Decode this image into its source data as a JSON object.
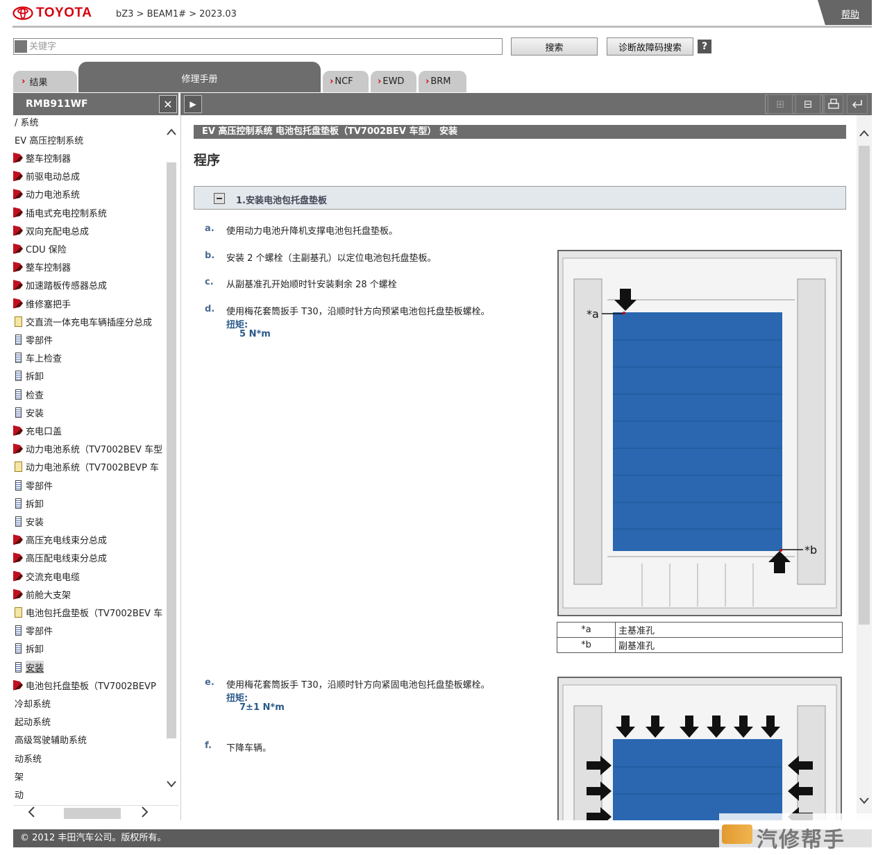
{
  "brand": {
    "name": "TOYOTA",
    "color": "#d7000f"
  },
  "breadcrumb": "bZ3 > BEAM1# > 2023.03",
  "help_label": "帮助",
  "search": {
    "placeholder": "关键字",
    "value": "",
    "search_button": "搜索",
    "dtc_button": "诊断故障码搜索",
    "help_button": "?"
  },
  "tabs": {
    "results": "结果",
    "manual": "修理手册",
    "ncf": "NCF",
    "ewd": "EWD",
    "brm": "BRM"
  },
  "left_panel": {
    "title": "RMB911WF",
    "tree": [
      {
        "label": "/ 系统",
        "icon": "none"
      },
      {
        "label": "EV 高压控制系统",
        "icon": "none"
      },
      {
        "label": "整车控制器",
        "icon": "book"
      },
      {
        "label": "前驱电动总成",
        "icon": "book"
      },
      {
        "label": "动力电池系统",
        "icon": "book"
      },
      {
        "label": "插电式充电控制系统",
        "icon": "book"
      },
      {
        "label": "双向充配电总成",
        "icon": "book"
      },
      {
        "label": "CDU 保险",
        "icon": "book"
      },
      {
        "label": "整车控制器",
        "icon": "book"
      },
      {
        "label": "加速踏板传感器总成",
        "icon": "book"
      },
      {
        "label": "维修塞把手",
        "icon": "book"
      },
      {
        "label": "交直流一体充电车辆插座分总成",
        "icon": "folder"
      },
      {
        "label": "零部件",
        "icon": "doc"
      },
      {
        "label": "车上检查",
        "icon": "doc"
      },
      {
        "label": "拆卸",
        "icon": "doc"
      },
      {
        "label": "检查",
        "icon": "doc"
      },
      {
        "label": "安装",
        "icon": "doc"
      },
      {
        "label": "充电口盖",
        "icon": "book"
      },
      {
        "label": "动力电池系统（TV7002BEV 车型",
        "icon": "book"
      },
      {
        "label": "动力电池系统（TV7002BEVP 车",
        "icon": "folder"
      },
      {
        "label": "零部件",
        "icon": "doc"
      },
      {
        "label": "拆卸",
        "icon": "doc"
      },
      {
        "label": "安装",
        "icon": "doc"
      },
      {
        "label": "高压充电线束分总成",
        "icon": "book"
      },
      {
        "label": "高压配电线束分总成",
        "icon": "book"
      },
      {
        "label": "交流充电电缆",
        "icon": "book"
      },
      {
        "label": "前舱大支架",
        "icon": "book"
      },
      {
        "label": "电池包托盘垫板（TV7002BEV 车",
        "icon": "folder"
      },
      {
        "label": "零部件",
        "icon": "doc"
      },
      {
        "label": "拆卸",
        "icon": "doc"
      },
      {
        "label": "安装",
        "icon": "doc",
        "selected": true
      },
      {
        "label": "电池包托盘垫板（TV7002BEVP",
        "icon": "book"
      },
      {
        "label": "冷却系统",
        "icon": "none"
      },
      {
        "label": "起动系统",
        "icon": "none"
      },
      {
        "label": "高级驾驶辅助系统",
        "icon": "none"
      },
      {
        "label": "动系统",
        "icon": "none"
      },
      {
        "label": "架",
        "icon": "none"
      },
      {
        "label": "动",
        "icon": "none"
      }
    ]
  },
  "content": {
    "title_bar": "EV 高压控制系统  电池包托盘垫板（TV7002BEV 车型）  安装",
    "heading": "程序",
    "step_title": "1.安装电池包托盘垫板",
    "substeps": [
      {
        "letter": "a.",
        "text": "使用动力电池升降机支撑电池包托盘垫板。"
      },
      {
        "letter": "b.",
        "text": "安装 2 个螺栓（主副基孔）以定位电池包托盘垫板。"
      },
      {
        "letter": "c.",
        "text": "从副基准孔开始顺时针安装剩余 28 个螺栓"
      },
      {
        "letter": "d.",
        "text": "使用梅花套筒扳手 T30，沿顺时针方向预紧电池包托盘垫板螺栓。",
        "torque_label": "扭矩:",
        "torque_value": "5 N*m"
      },
      {
        "letter": "e.",
        "text": "使用梅花套筒扳手 T30，沿顺时针方向紧固电池包托盘垫板螺栓。",
        "torque_label": "扭矩:",
        "torque_value": "7±1 N*m"
      },
      {
        "letter": "f.",
        "text": "下降车辆。"
      }
    ],
    "figure1": {
      "callout_a": "*a",
      "callout_b": "*b"
    },
    "legend": [
      {
        "key": "*a",
        "value": "主基准孔"
      },
      {
        "key": "*b",
        "value": "副基准孔"
      }
    ]
  },
  "footer": "© 2012 丰田汽车公司。版权所有。",
  "watermark": "汽修帮手",
  "colors": {
    "panel_gray": "#6d6d6d",
    "pad_blue": "#2a67b0"
  }
}
